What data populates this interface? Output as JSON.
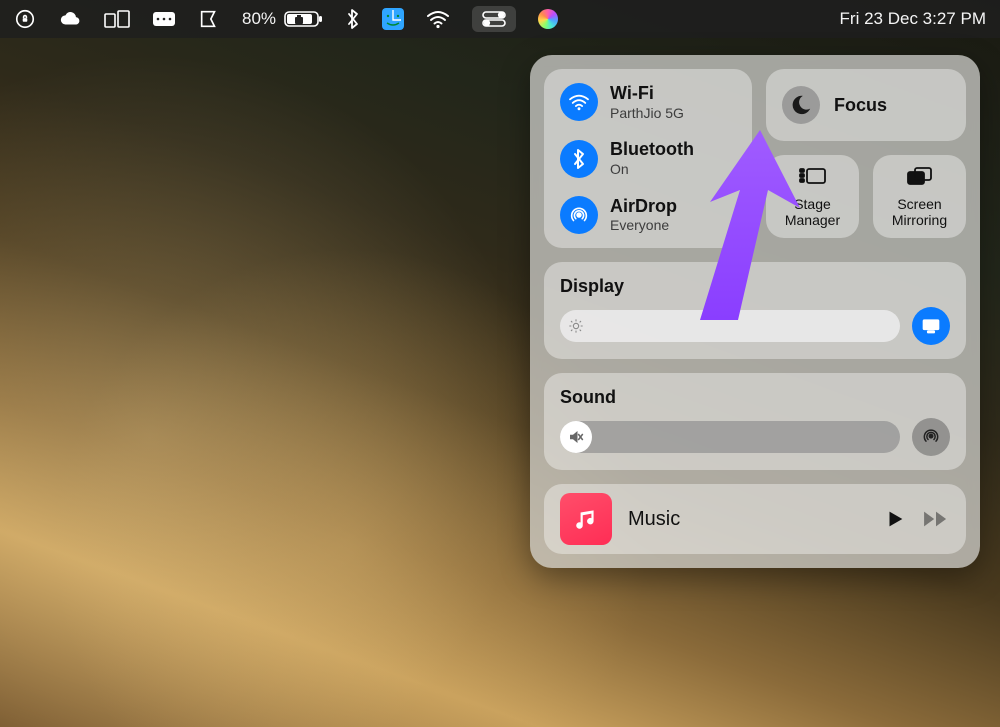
{
  "menubar": {
    "battery_percent": "80%",
    "datetime": "Fri 23 Dec  3:27 PM"
  },
  "cc": {
    "wifi": {
      "title": "Wi-Fi",
      "sub": "ParthJio 5G"
    },
    "bluetooth": {
      "title": "Bluetooth",
      "sub": "On"
    },
    "airdrop": {
      "title": "AirDrop",
      "sub": "Everyone"
    },
    "focus": {
      "title": "Focus"
    },
    "stage": {
      "l1": "Stage",
      "l2": "Manager"
    },
    "mirror": {
      "l1": "Screen",
      "l2": "Mirroring"
    },
    "display_hdr": "Display",
    "sound_hdr": "Sound",
    "music_label": "Music"
  }
}
